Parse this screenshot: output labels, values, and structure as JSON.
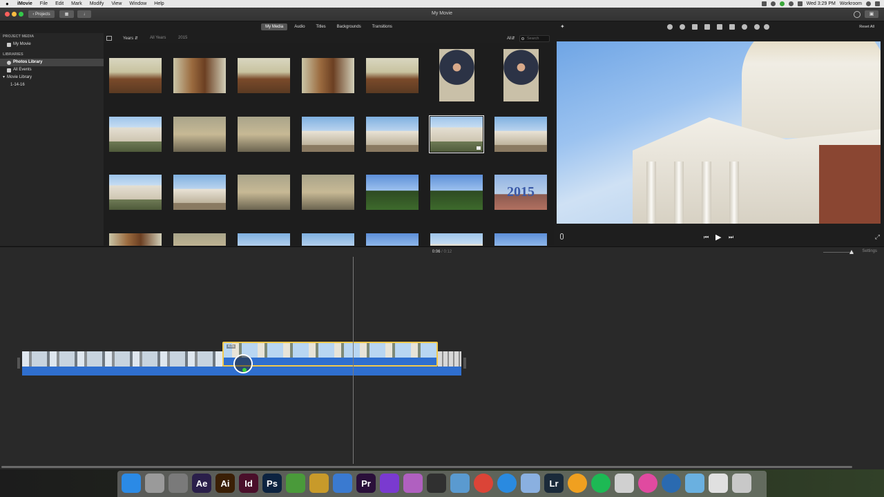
{
  "menubar": {
    "app_name": "iMovie",
    "items": [
      "File",
      "Edit",
      "Mark",
      "Modify",
      "View",
      "Window",
      "Help"
    ],
    "clock": "Wed 3:29 PM",
    "user": "Workroom"
  },
  "toolbar": {
    "projects_label": "Projects",
    "window_title": "My Movie",
    "layout_icon": "grid-icon",
    "import_icon": "arrow-down-icon"
  },
  "sidebar": {
    "project_media_header": "PROJECT MEDIA",
    "project_item": "My Movie",
    "libraries_header": "LIBRARIES",
    "items": [
      {
        "label": "Photos Library",
        "selected": true
      },
      {
        "label": "All Events",
        "selected": false
      },
      {
        "label": "Movie Library",
        "selected": false
      },
      {
        "label": "1-14-16",
        "selected": false
      }
    ]
  },
  "media_tabs": {
    "tabs": [
      "My Media",
      "Audio",
      "Titles",
      "Backgrounds",
      "Transitions"
    ],
    "active": "My Media"
  },
  "filter": {
    "years": "Years",
    "all_years": "All Years",
    "year": "2015",
    "all": "All",
    "search_placeholder": "Search"
  },
  "grid": {
    "year_thumb_text": "2015"
  },
  "viewer": {
    "reset_all": "Reset All"
  },
  "timeline": {
    "current_time": "0:06",
    "total_time": "0:12",
    "settings_label": "Settings",
    "clip_duration": "4.0s"
  },
  "dock": {
    "apps": [
      {
        "name": "finder",
        "label": "",
        "color": "#2b8ae6"
      },
      {
        "name": "launchpad",
        "label": "",
        "color": "#9a9a9a"
      },
      {
        "name": "system-preferences",
        "label": "",
        "color": "#7a7a7a"
      },
      {
        "name": "after-effects",
        "label": "Ae",
        "color": "#2a1f4a"
      },
      {
        "name": "illustrator",
        "label": "Ai",
        "color": "#3a1f05"
      },
      {
        "name": "indesign",
        "label": "Id",
        "color": "#4a0f2a"
      },
      {
        "name": "photoshop",
        "label": "Ps",
        "color": "#0c2340"
      },
      {
        "name": "app-frog",
        "label": "",
        "color": "#4a9a3a"
      },
      {
        "name": "app-pineapple",
        "label": "",
        "color": "#c89a2a"
      },
      {
        "name": "app-tools",
        "label": "",
        "color": "#3a7ad0"
      },
      {
        "name": "premiere",
        "label": "Pr",
        "color": "#2a0f3a"
      },
      {
        "name": "imovie",
        "label": "",
        "color": "#7a3ad0"
      },
      {
        "name": "motion",
        "label": "",
        "color": "#b060c0"
      },
      {
        "name": "final-cut",
        "label": "",
        "color": "#303030"
      },
      {
        "name": "preview",
        "label": "",
        "color": "#5a9ad0"
      },
      {
        "name": "chrome",
        "label": "",
        "color": "#db4437"
      },
      {
        "name": "safari",
        "label": "",
        "color": "#2a8ae0"
      },
      {
        "name": "app-feather",
        "label": "",
        "color": "#8ab0e0"
      },
      {
        "name": "lightroom",
        "label": "Lr",
        "color": "#1a2a3a"
      },
      {
        "name": "photos",
        "label": "",
        "color": "#f0a020"
      },
      {
        "name": "spotify",
        "label": "",
        "color": "#1db954"
      },
      {
        "name": "app-hat",
        "label": "",
        "color": "#d0d0d0"
      },
      {
        "name": "itunes",
        "label": "",
        "color": "#e04aa0"
      },
      {
        "name": "app-q",
        "label": "",
        "color": "#2a6ab0"
      },
      {
        "name": "folder",
        "label": "",
        "color": "#6ab0e0"
      },
      {
        "name": "downloads",
        "label": "",
        "color": "#e0e0e0"
      },
      {
        "name": "trash",
        "label": "",
        "color": "#c8c8c8"
      }
    ]
  }
}
